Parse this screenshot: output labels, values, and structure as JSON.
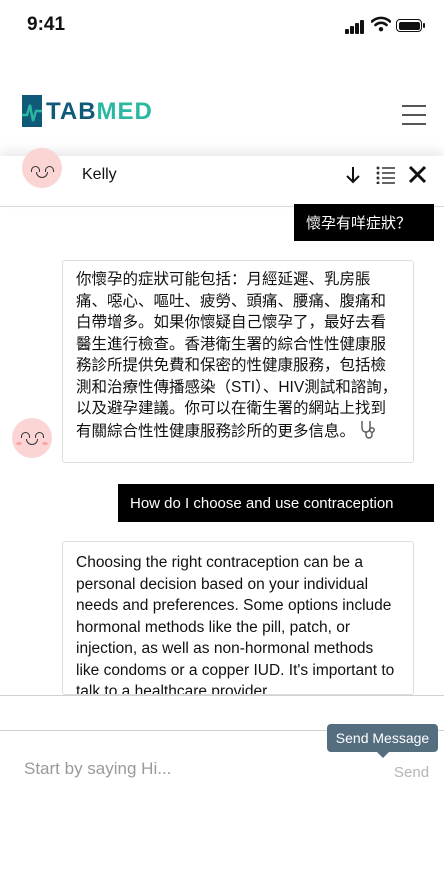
{
  "status_bar": {
    "time": "9:41"
  },
  "header": {
    "logo_text_1": "TAB",
    "logo_text_2": "MED"
  },
  "chat_header": {
    "name": "Kelly"
  },
  "messages": [
    {
      "role": "user",
      "text": "懷孕有咩症狀？"
    },
    {
      "role": "bot",
      "text": "你懷孕的症狀可能包括：月經延遲、乳房脹痛、噁心、嘔吐、疲勞、頭痛、腰痛、腹痛和白帶增多。如果你懷疑自己懷孕了，最好去看醫生進行檢查。香港衛生署的綜合性性健康服務診所提供免費和保密的性健康服務，包括檢測和治療性傳播感染（STI）、HIV測試和諮詢，以及避孕建議。你可以在衛生署的網站上找到有關綜合性性健康服務診所的更多信息。"
    },
    {
      "role": "user",
      "text": "How do I choose and use contraception"
    },
    {
      "role": "bot",
      "text": "Choosing the right contraception can be a personal decision based on your individual needs and preferences. Some options include hormonal methods like the pill, patch, or injection, as well as non-hormonal methods like condoms or a copper IUD. It's important to talk to a healthcare provider"
    }
  ],
  "input": {
    "placeholder": "Start by saying Hi...",
    "value": ""
  },
  "send": {
    "label": "Send",
    "tooltip": "Send Message"
  },
  "icons": {
    "logo": "heartbeat-bar-icon",
    "menu": "hamburger-menu-icon",
    "download": "arrow-down-icon",
    "list": "list-icon",
    "close": "close-icon",
    "doctor": "stethoscope-icon",
    "avatar": "smiling-face-icon"
  },
  "colors": {
    "brand_dark": "#0f5a78",
    "brand_accent": "#2ab9a0",
    "user_bubble": "#000000",
    "tooltip": "#546e80",
    "avatar": "#fbd4d4"
  }
}
